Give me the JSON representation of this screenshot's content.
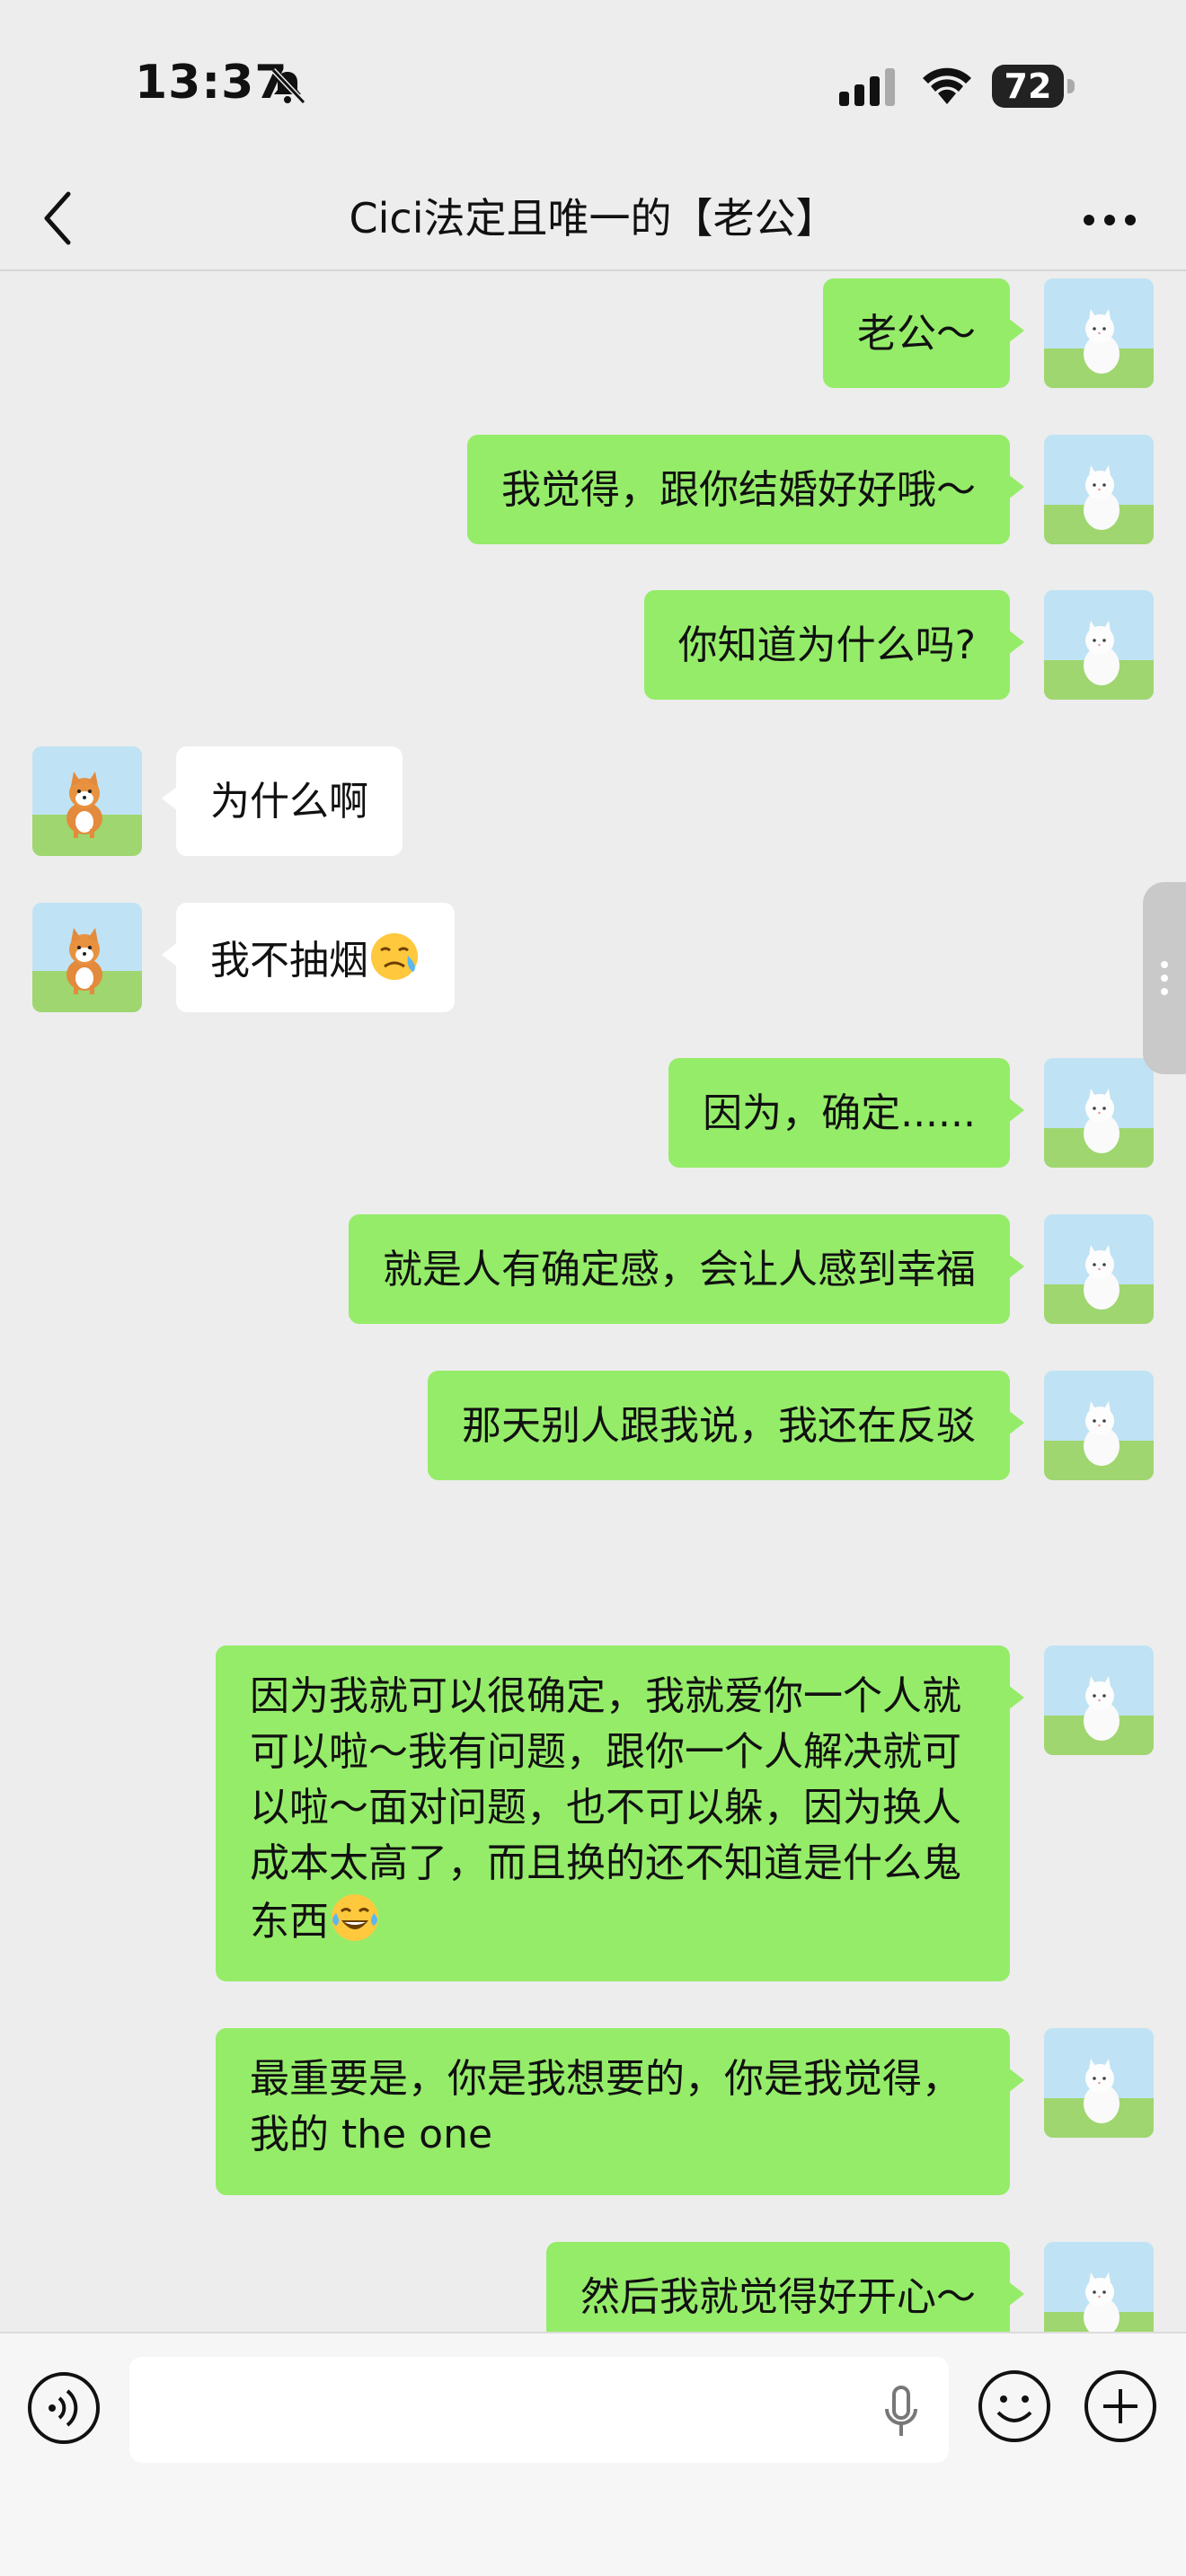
{
  "status_bar": {
    "time": "13:37",
    "battery": "72",
    "mute_icon": "bell-slash-icon",
    "signal_icon": "cellular-signal-icon",
    "wifi_icon": "wifi-icon"
  },
  "header": {
    "title": "Cici法定且唯一的【老公】",
    "back_icon": "chevron-left-icon",
    "more_icon": "more-dots-icon"
  },
  "messages": [
    {
      "side": "out",
      "text": "老公～"
    },
    {
      "side": "out",
      "text": "我觉得，跟你结婚好好哦～"
    },
    {
      "side": "out",
      "text": "你知道为什么吗?"
    },
    {
      "side": "in",
      "text": "为什么啊"
    },
    {
      "side": "in",
      "text": "我不抽烟",
      "emoji": "crying-face-emoji"
    },
    {
      "side": "out",
      "text": "因为，确定......"
    },
    {
      "side": "out",
      "text": "就是人有确定感，会让人感到幸福"
    },
    {
      "side": "out",
      "text": "那天别人跟我说，我还在反驳"
    },
    {
      "side": "out",
      "text": "因为我就可以很确定，我就爱你一个人就可以啦～我有问题，跟你一个人解决就可以啦～面对问题，也不可以躲，因为换人成本太高了，而且换的还不知道是什么鬼东西",
      "emoji": "tears-of-joy-emoji"
    },
    {
      "side": "out",
      "text": "最重要是，你是我想要的，你是我觉得，我的 the one"
    },
    {
      "side": "out",
      "text": "然后我就觉得好开心～"
    }
  ],
  "input_bar": {
    "voice_icon": "voice-input-icon",
    "mic_icon": "microphone-icon",
    "emoji_icon": "emoji-face-icon",
    "plus_icon": "plus-circle-icon"
  },
  "colors": {
    "outgoing_bubble": "#95ec69",
    "incoming_bubble": "#ffffff",
    "chat_background": "#ededed"
  }
}
